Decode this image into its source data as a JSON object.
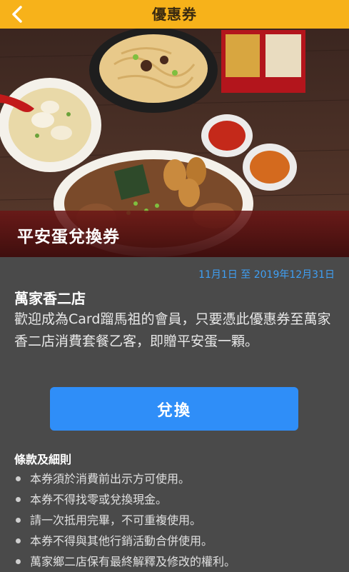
{
  "header": {
    "title": "優惠券"
  },
  "coupon": {
    "title": "平安蛋兌換券",
    "date_range": "11月1日 至 2019年12月31日",
    "store_name": "萬家香二店",
    "description": "歡迎成為Card蹓馬祖的會員，只要憑此優惠券至萬家香二店消費套餐乙客，即贈平安蛋一顆。",
    "redeem_label": "兌換"
  },
  "terms": {
    "heading": "條款及細則",
    "items": [
      "本券須於消費前出示方可使用。",
      "本券不得找零或兌換現金。",
      "請一次抵用完畢，不可重複使用。",
      "本券不得與其他行銷活動合併使用。",
      "萬家鄉二店保有最終解釋及修改的權利。"
    ]
  },
  "colors": {
    "header_bg": "#f7b21a",
    "page_bg": "#4a4a4a",
    "accent_blue": "#2f8ef8",
    "date_blue": "#3fa0f5"
  }
}
